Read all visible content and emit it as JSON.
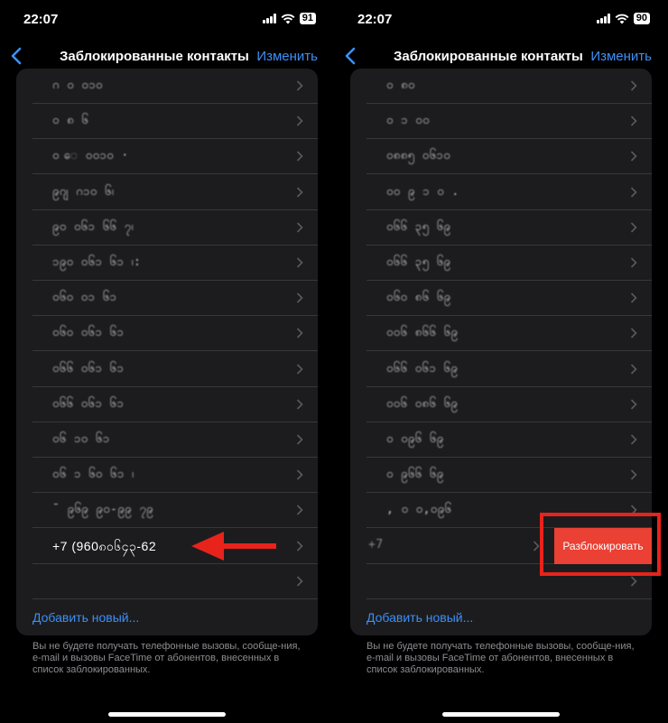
{
  "colors": {
    "accent": "#3d8ff5",
    "destructive": "#eb4034",
    "annotation": "#e8231b"
  },
  "screens": [
    {
      "status": {
        "time": "22:07",
        "battery": "91"
      },
      "nav": {
        "title": "Заблокированные контакты",
        "edit": "Изменить"
      },
      "contacts": [
        "ဂ ဝ  ၀၁၀",
        "ဝ  ၈  ၆",
        "ဝ ေ ၀၀၁၀ ·",
        "၉ဂျ ဂ၁၀ ၆၊",
        "၉ဝ ဝ၆၁ ၆၆ ၇၊",
        "၁၉၀ ဝ၆၁ ၆၁ ၊:",
        "၀၆ဝ ဝ၁ ၆၁",
        "၀၆ဝ ဝ၆၁ ၆၁",
        "ဝ၆၆ ဝ၆၁ ၆၁",
        "ဝ၆၆ ဝ၆၁ ၆၁",
        "ဝ၆ ၁ဝ  ၆၁",
        "၀၆ ၁ ၆၀  ၆၁ ၊",
        "ˉ ၉၆၉ ၉၀-၉၉ ၇၉",
        "+7 (960၈၀၆၄၃-62",
        " "
      ],
      "add_new": "Добавить новый...",
      "footnote": "Вы не будете получать телефонные вызовы, сообще-ния, e-mail и вызовы FaceTime от абонентов, внесенных в список заблокированных."
    },
    {
      "status": {
        "time": "22:07",
        "battery": "90"
      },
      "nav": {
        "title": "Заблокированные контакты",
        "edit": "Изменить"
      },
      "contacts": [
        "ဝ  ၈၀",
        "ဝ  ၁ ၀၀",
        "ဝ၈၈၅ ဝ၆၁၀",
        "ဝ၀ ၉ ၁ ၀ .",
        "ဝ၆၆ ၃၅ ၆၉",
        "ဝ၆၆ ၃၅ ၆၉",
        "၀၆၀ ၈၆ ၆၉",
        "ဝ၀၆ ၈၆၆ ၆၉",
        "ဝ၆၆ ဝ၆၁ ၆၉",
        "ဝ၀၆ ဝ၈၆ ၆၉",
        "၀ ၀၉၆ ၆၉",
        "ဝ ၉၆၆ ၆၉",
        ", ၀ ၀,၀၉၆ ",
        "+7",
        " "
      ],
      "add_new": "Добавить новый...",
      "footnote": "Вы не будете получать телефонные вызовы, сообще-ния, e-mail и вызовы FaceTime от абонентов, внесенных в список заблокированных.",
      "unblock": "Разблокировать"
    }
  ]
}
